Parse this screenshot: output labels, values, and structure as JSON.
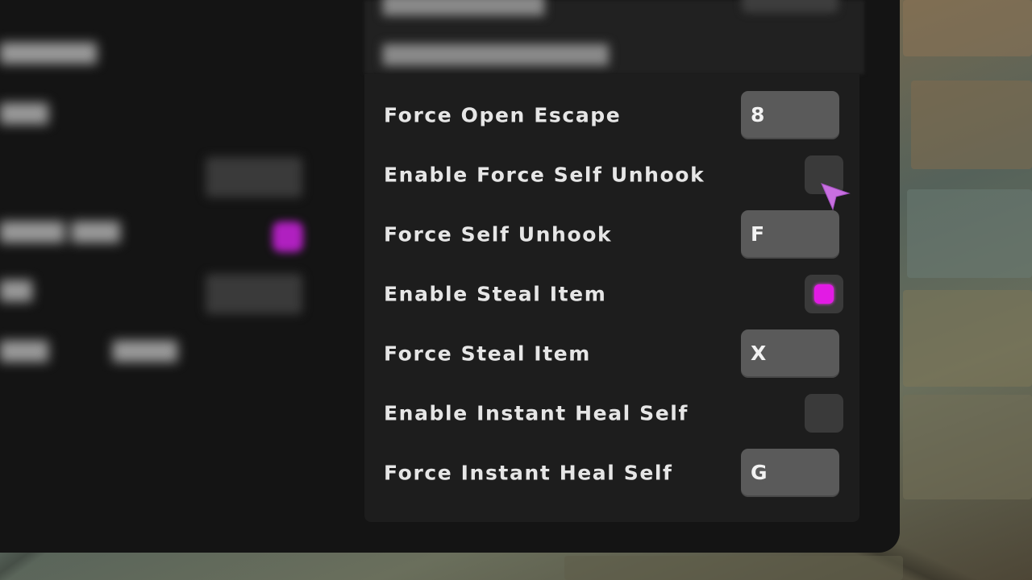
{
  "menu": {
    "rows": [
      {
        "label": "Force Open Escape",
        "type": "key",
        "value": "8"
      },
      {
        "label": "Enable Force Self Unhook",
        "type": "toggle",
        "checked": false
      },
      {
        "label": "Force Self Unhook",
        "type": "key",
        "value": "F"
      },
      {
        "label": "Enable Steal Item",
        "type": "toggle",
        "checked": true
      },
      {
        "label": "Force Steal Item",
        "type": "key",
        "value": "X"
      },
      {
        "label": "Enable Instant Heal Self",
        "type": "toggle",
        "checked": false
      },
      {
        "label": "Force Instant Heal Self",
        "type": "key",
        "value": "G"
      }
    ]
  },
  "colors": {
    "accent": "#e21be4",
    "panel": "#1d1d1d",
    "keybox": "#5a5a5a",
    "cursor": "#c86fe0"
  },
  "icons": {
    "cursor": "pointer-arrow-icon"
  }
}
